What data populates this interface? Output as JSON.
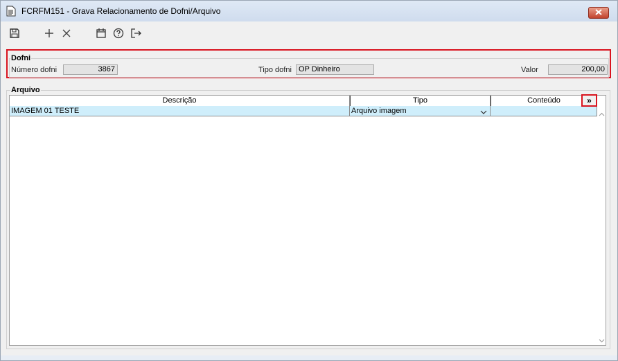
{
  "window": {
    "title": "FCRFM151 - Grava Relacionamento de Dofni/Arquivo"
  },
  "toolbar": {
    "icons": [
      "save-icon",
      "add-icon",
      "delete-icon",
      "calendar-icon",
      "help-icon",
      "exit-icon"
    ]
  },
  "dofni": {
    "legend": "Dofni",
    "numero_label": "Número dofni",
    "numero_value": "3867",
    "tipo_label": "Tipo dofni",
    "tipo_value": "OP Dinheiro",
    "valor_label": "Valor",
    "valor_value": "200,00"
  },
  "arquivo": {
    "legend": "Arquivo",
    "columns": [
      "Descrição",
      "Tipo",
      "Conteúdo"
    ],
    "expand_label": "»",
    "rows": [
      {
        "descricao": "IMAGEM 01 TESTE",
        "tipo": "Arquivo imagem",
        "conteudo": ""
      }
    ]
  },
  "colors": {
    "highlight_border": "#d9141f",
    "selected_row": "#cfeefb"
  }
}
